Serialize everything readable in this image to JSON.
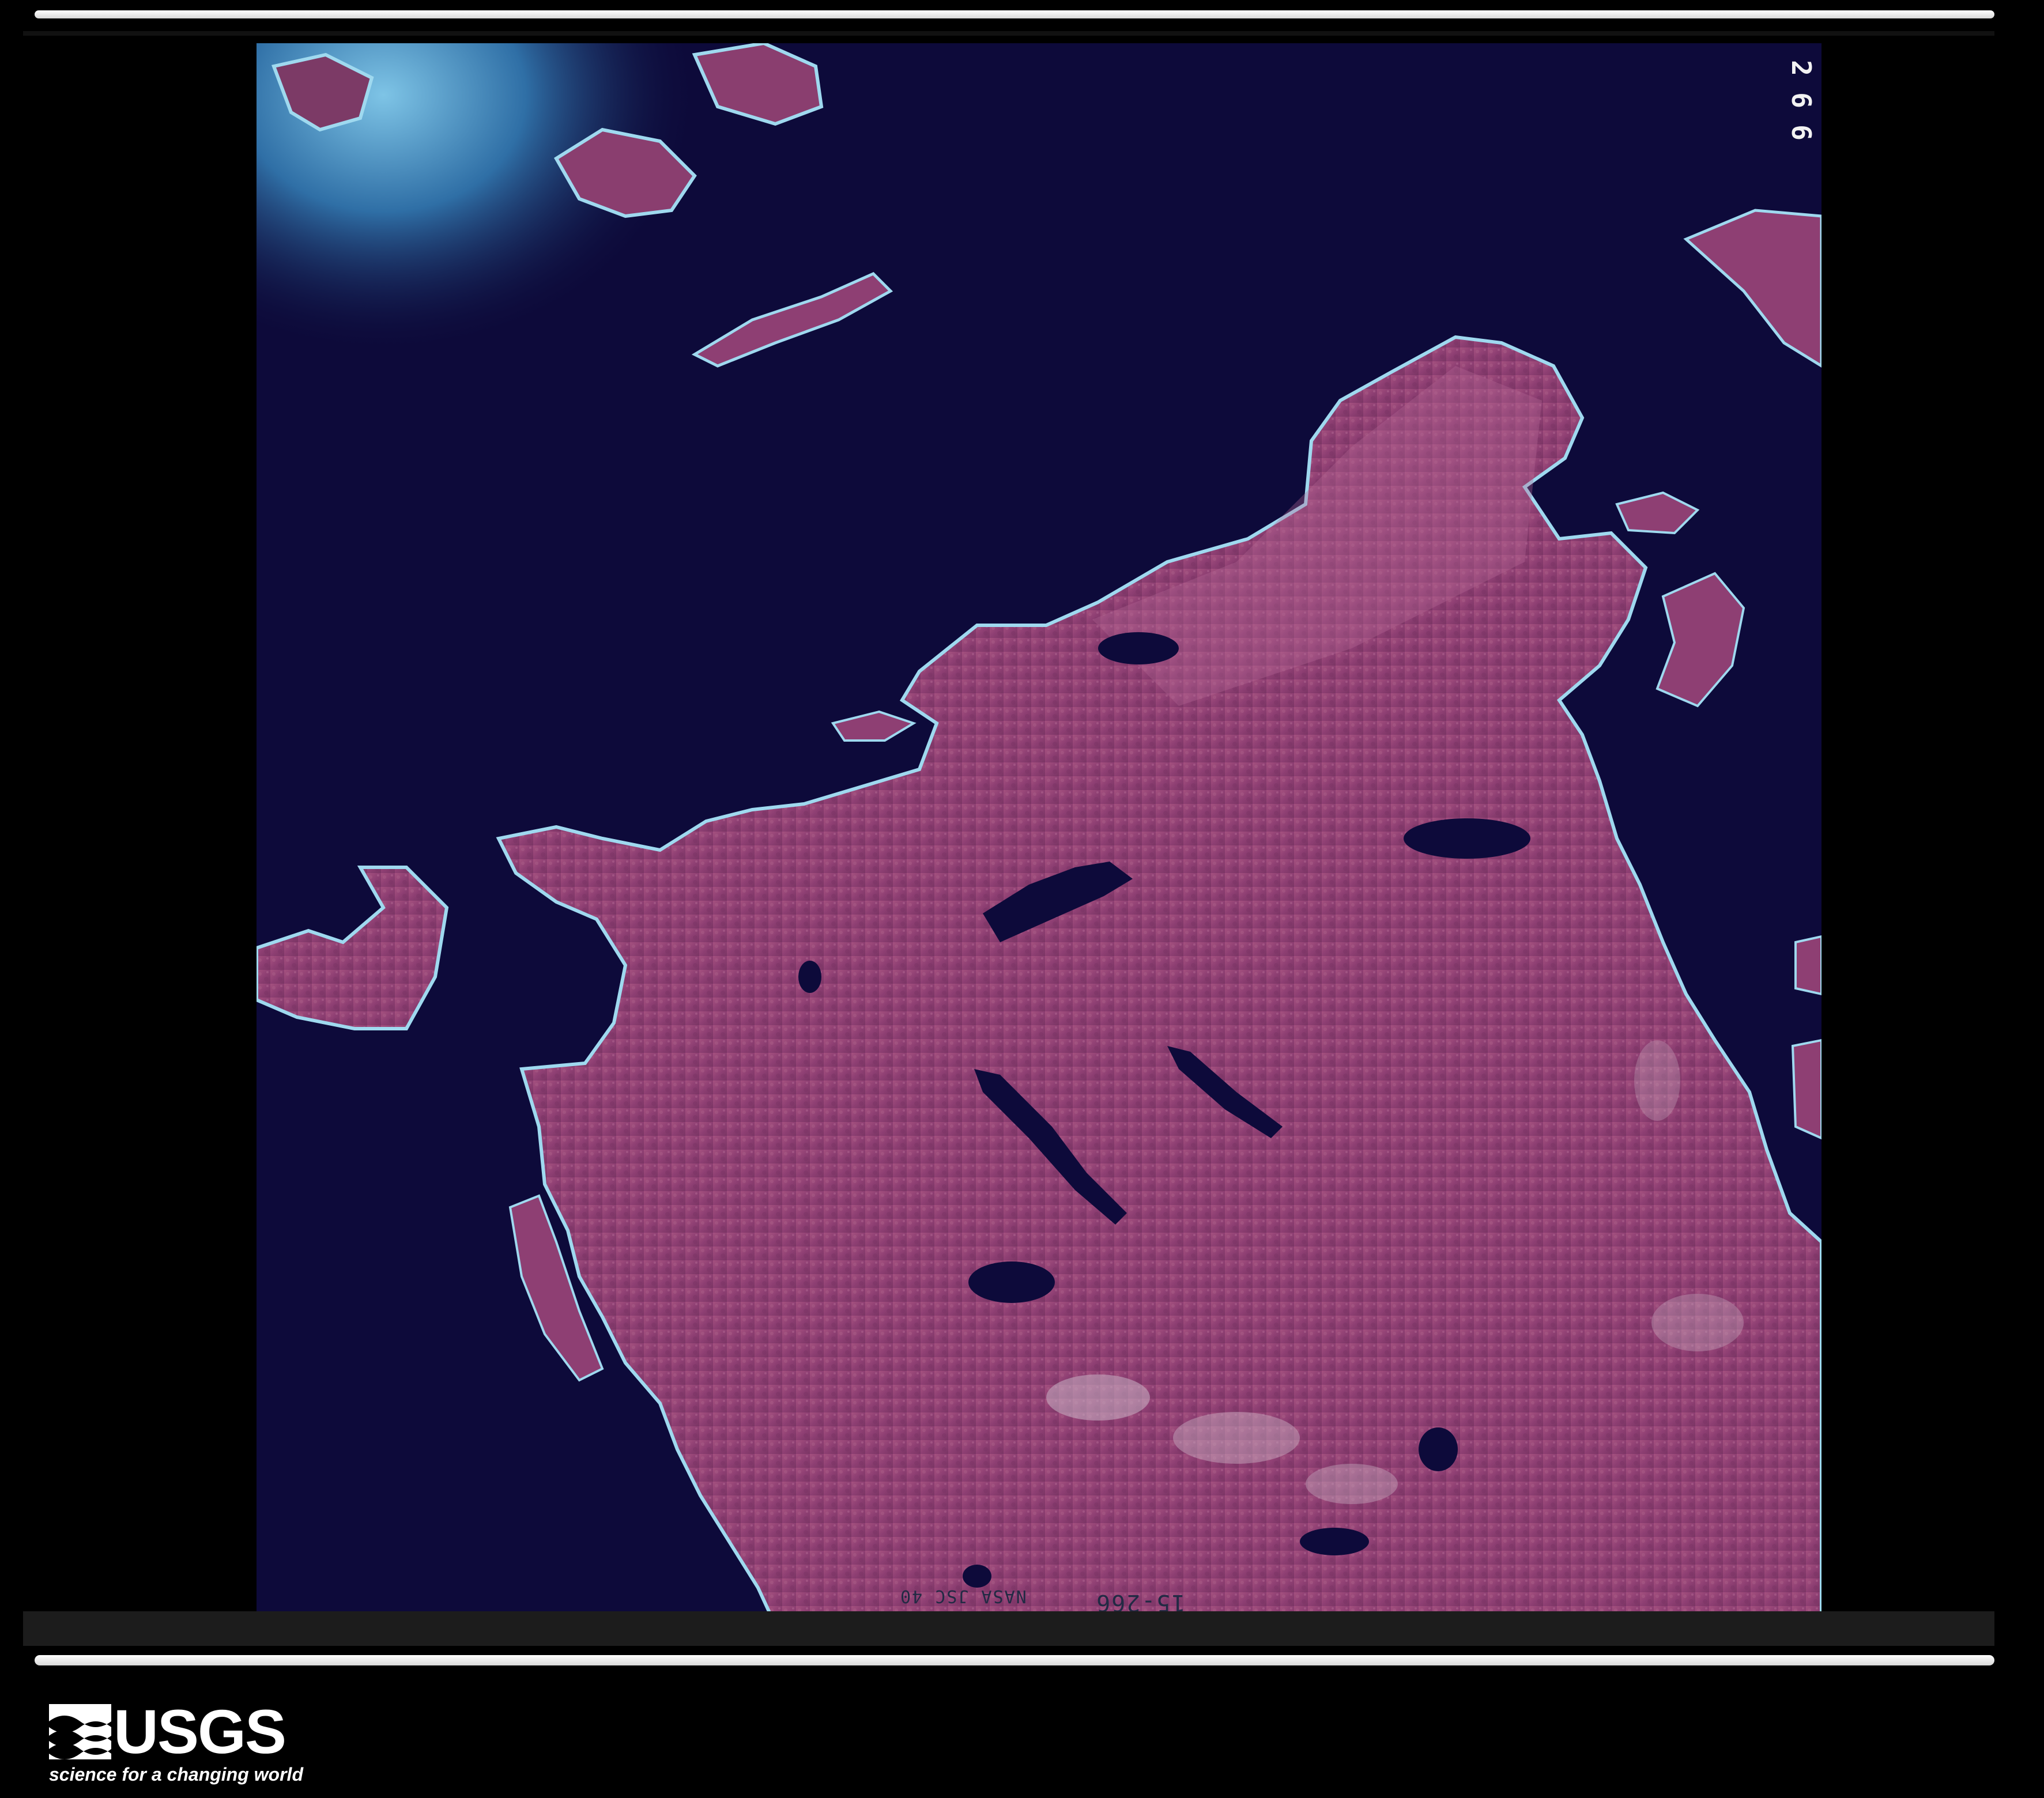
{
  "photo": {
    "frame_number": "266",
    "edge_print_roll": "15-266",
    "edge_print_agency": "NASA JSC 40",
    "colors": {
      "water": "#0d0a3a",
      "shallow_water": "#3f86b8",
      "land": "#8e3f73",
      "land_highlight": "#b56696",
      "rock": "#c9b2c4",
      "coast_surf": "#8fd3ec"
    }
  },
  "logo": {
    "wordmark": "USGS",
    "tagline": "science for a changing world"
  }
}
